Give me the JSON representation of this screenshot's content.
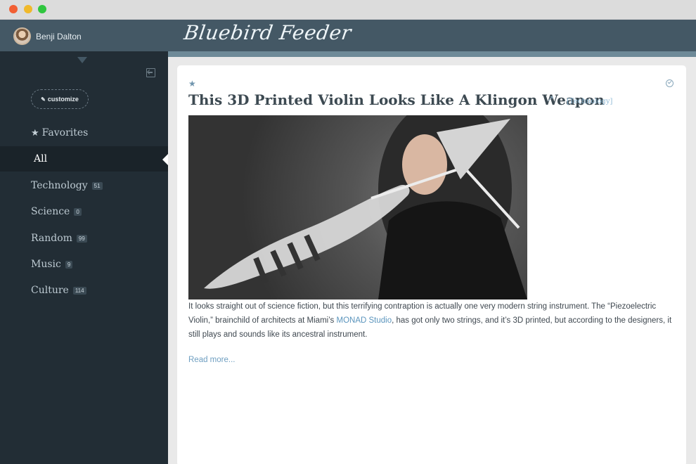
{
  "header": {
    "user_name": "Benji Dalton",
    "brand": "Bluebird Feeder"
  },
  "sidebar": {
    "customize_label": "customize",
    "items": [
      {
        "label": "Favorites",
        "icon": "star-icon"
      },
      {
        "label": "All",
        "active": true
      },
      {
        "label": "Technology",
        "count": "51"
      },
      {
        "label": "Science",
        "count": "0"
      },
      {
        "label": "Random",
        "count": "99"
      },
      {
        "label": "Music",
        "count": "9"
      },
      {
        "label": "Culture",
        "count": "114"
      }
    ]
  },
  "article": {
    "title": "This 3D Printed Violin Looks Like A Klingon Weapon",
    "category": "[Technology]",
    "body_before": "It looks straight out of science fiction, but this terrifying contraption is actually one very modern string instrument. The “Piezoelectric Violin,” brainchild of architects at Miami’s ",
    "body_link": "MONAD Studio",
    "body_after": ", has got only two strings, and it’s 3D printed, but according to the designers, it still plays and sounds like its ancestral instrument.",
    "read_more": "Read more..."
  },
  "colors": {
    "header": "#445865",
    "sidebar": "#222d35",
    "accent": "#6f9fc1"
  }
}
